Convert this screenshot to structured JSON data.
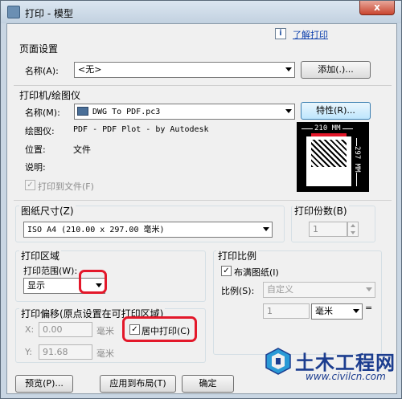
{
  "window": {
    "title": "打印 - 模型",
    "close_label": "x"
  },
  "help": {
    "icon_glyph": "i",
    "link": "了解打印"
  },
  "page_setup": {
    "section": "页面设置",
    "name_label": "名称(A):",
    "name_value": "<无>",
    "add_button": "添加(.)..."
  },
  "printer": {
    "section": "打印机/绘图仪",
    "name_label": "名称(M):",
    "name_value": "DWG To PDF.pc3",
    "properties_button": "特性(R)...",
    "plotter_label": "绘图仪:",
    "plotter_value": "PDF - PDF Plot - by Autodesk",
    "where_label": "位置:",
    "where_value": "文件",
    "desc_label": "说明:",
    "print_to_file_label": "打印到文件(F)",
    "print_to_file_checked": true,
    "preview_width": "210 MM",
    "preview_height": "297 MM"
  },
  "paper_size": {
    "section": "图纸尺寸(Z)",
    "value": "ISO A4 (210.00 x 297.00 毫米)"
  },
  "copies": {
    "section": "打印份数(B)",
    "value": "1"
  },
  "plot_area": {
    "section": "打印区域",
    "range_label": "打印范围(W):",
    "range_value": "显示"
  },
  "plot_scale": {
    "section": "打印比例",
    "fit_label": "布满图纸(I)",
    "fit_checked": true,
    "scale_label": "比例(S):",
    "scale_value": "自定义",
    "units_value": "1",
    "units_select": "毫米",
    "equals": "="
  },
  "plot_offset": {
    "section": "打印偏移(原点设置在可打印区域)",
    "x_label": "X:",
    "x_value": "0.00",
    "x_unit": "毫米",
    "y_label": "Y:",
    "y_value": "91.68",
    "y_unit": "毫米",
    "center_label": "居中打印(C)",
    "center_checked": true
  },
  "footer": {
    "preview_button": "预览(P)...",
    "apply_button": "应用到布局(T)",
    "ok_button": "确定"
  },
  "watermark": {
    "title": "土木工程网",
    "url": "www.civilcn.com",
    "brand_color": "#1c3d8f"
  },
  "colors": {
    "highlight_ring": "#e3182a",
    "accent": "#3c7fb1"
  }
}
